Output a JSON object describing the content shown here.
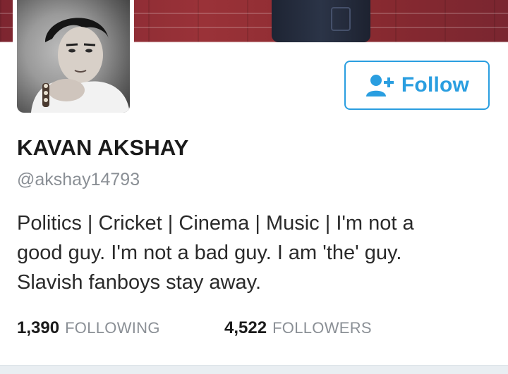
{
  "colors": {
    "accent": "#2a9ee0",
    "banner": "#8a2a30",
    "muted_text": "#8a8f95",
    "primary_text": "#1a1a1a"
  },
  "profile": {
    "display_name": "KAVAN AKSHAY",
    "handle": "@akshay14793",
    "bio_lines": [
      "Politics | Cricket | Cinema | Music | I'm not a",
      "good guy. I'm not a bad guy. I am 'the' guy.",
      "Slavish fanboys stay away."
    ]
  },
  "follow_button": {
    "label": "Follow",
    "icon": "add-user-icon"
  },
  "stats": {
    "following_count": "1,390",
    "following_label": "FOLLOWING",
    "followers_count": "4,522",
    "followers_label": "FOLLOWERS"
  }
}
